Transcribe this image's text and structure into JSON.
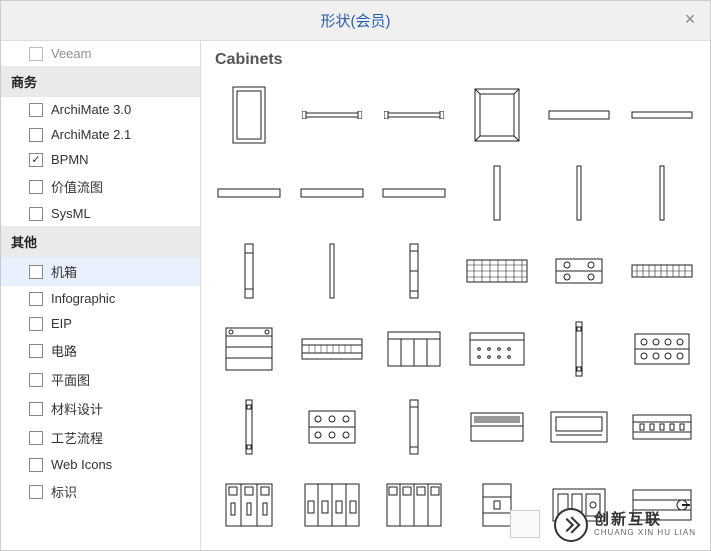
{
  "dialog": {
    "title": "形状(会员)"
  },
  "sidebar": {
    "partial_top_item": "Veeam",
    "groups": [
      {
        "header": "商务",
        "items": [
          {
            "label": "ArchiMate 3.0",
            "checked": false
          },
          {
            "label": "ArchiMate 2.1",
            "checked": false
          },
          {
            "label": "BPMN",
            "checked": true
          },
          {
            "label": "价值流图",
            "checked": false
          },
          {
            "label": "SysML",
            "checked": false
          }
        ]
      },
      {
        "header": "其他",
        "items": [
          {
            "label": "机箱",
            "checked": false,
            "selected": true
          },
          {
            "label": "Infographic",
            "checked": false
          },
          {
            "label": "EIP",
            "checked": false
          },
          {
            "label": "电路",
            "checked": false
          },
          {
            "label": "平面图",
            "checked": false
          },
          {
            "label": "材料设计",
            "checked": false
          },
          {
            "label": "工艺流程",
            "checked": false
          },
          {
            "label": "Web Icons",
            "checked": false
          },
          {
            "label": "标识",
            "checked": false
          }
        ]
      }
    ]
  },
  "main": {
    "header": "Cabinets",
    "shape_count": 36,
    "grid_columns": 6
  },
  "footer": {
    "brand_cn": "创新互联",
    "brand_pinyin": "CHUANG XIN HU LIAN"
  }
}
